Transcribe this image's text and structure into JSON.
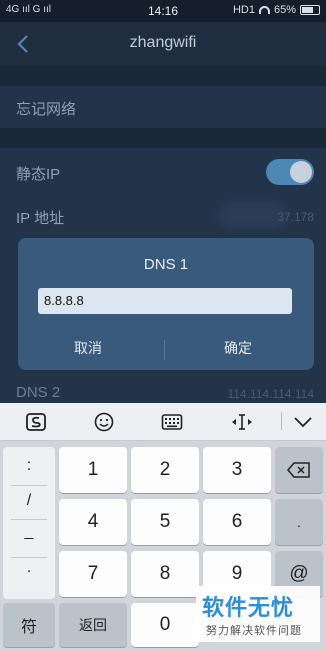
{
  "status_bar": {
    "left": "4G ııl G ııl",
    "time": "14:16",
    "right_prefix": "HD1",
    "battery": "65%"
  },
  "header": {
    "title": "zhangwifi"
  },
  "settings": {
    "forget": "忘记网络",
    "static_ip": "静态IP",
    "ip_label": "IP 地址",
    "ip_value": "37.178",
    "dns2_label": "DNS 2",
    "dns2_value": "114.114.114.114"
  },
  "dialog": {
    "title": "DNS 1",
    "input_value": "8.8.8.8",
    "cancel": "取消",
    "confirm": "确定"
  },
  "keyboard": {
    "side_keys": [
      ":",
      "/",
      "_",
      "."
    ],
    "row1": [
      "1",
      "2",
      "3"
    ],
    "row2": [
      "4",
      "5",
      "6"
    ],
    "row3": [
      "7",
      "8",
      "9"
    ],
    "right_dot": ".",
    "at": "@",
    "symbol": "符",
    "back": "返回",
    "zero": "0"
  },
  "watermark": {
    "main": "软件无忧",
    "sub": "努力解决软件问题"
  }
}
